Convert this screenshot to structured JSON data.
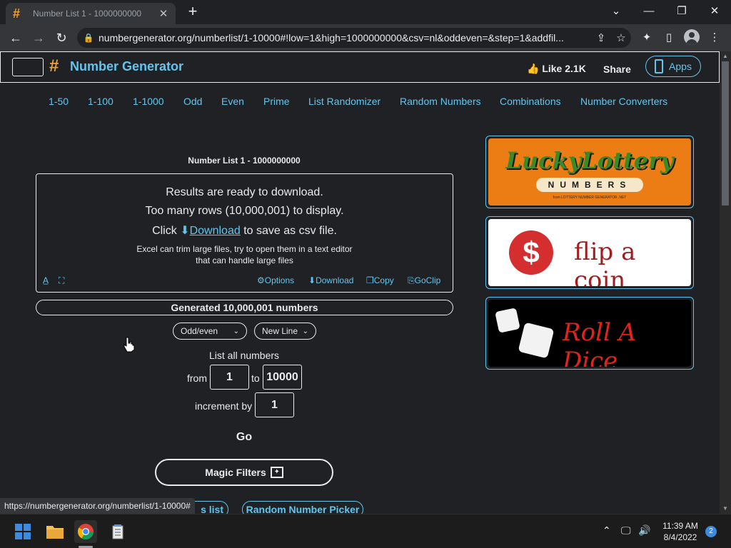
{
  "browser": {
    "tab_title": "Number List 1 - 1000000000",
    "url": "numbergenerator.org/numberlist/1-10000#!low=1&high=1000000000&csv=nl&oddeven=&step=1&addfil..."
  },
  "site": {
    "brand": "Number Generator",
    "like_label": "Like 2.1K",
    "share_label": "Share",
    "apps_label": "Apps",
    "nav": [
      "1-50",
      "1-100",
      "1-1000",
      "Odd",
      "Even",
      "Prime",
      "List Randomizer",
      "Random Numbers",
      "Combinations",
      "Number Converters"
    ]
  },
  "results": {
    "title": "Number List 1 - 1000000000",
    "line1": "Results are ready to download.",
    "line2": "Too many rows (10,000,001) to display.",
    "click": "Click",
    "download_link": "Download",
    "after_link": "to save as csv file.",
    "note1": "Excel can trim large files, try to open them in a text editor",
    "note2": "that can handle large files",
    "options": "Options",
    "download": "Download",
    "copy": "Copy",
    "goclip": "GoClip"
  },
  "generated": "Generated 10,000,001 numbers",
  "form": {
    "oddeven_selected": "Odd/even",
    "separator_selected": "New Line",
    "list_all": "List all numbers",
    "from_label": "from",
    "from_value": "1",
    "to_label": "to",
    "to_value": "10000",
    "increment_label": "increment by",
    "increment_value": "1",
    "go": "Go",
    "magic_filters": "Magic Filters"
  },
  "bottom_links": {
    "left_partial": "s list",
    "right": "Random Number Picker"
  },
  "ads": {
    "lottery_line1": "LuckyLottery",
    "lottery_line2": "NUMBERS",
    "lottery_small": "from LOTTERY NUMBER GENERATOR .NET",
    "coin_symbol": "$",
    "coin_text": "flip a coin",
    "dice_text": "Roll A Dice"
  },
  "status_url": "https://numbergenerator.org/numberlist/1-10000#",
  "taskbar": {
    "time": "11:39 AM",
    "date": "8/4/2022",
    "notifications": "2"
  },
  "colors": {
    "background": "#202124",
    "accent": "#63c5ee",
    "hash": "#e8a33d",
    "lottery_bg": "#ec7d14",
    "coin_red": "#d42e2e",
    "dice_red": "#e0241a"
  }
}
